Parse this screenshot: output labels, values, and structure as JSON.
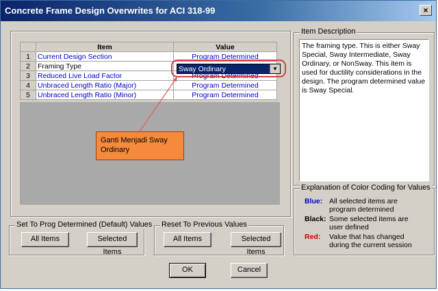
{
  "window": {
    "title": "Concrete Frame Design Overwrites for ACI 318-99",
    "close_label": "×"
  },
  "grid": {
    "headers": {
      "item": "Item",
      "value": "Value"
    },
    "rows": [
      {
        "num": "1",
        "item": "Current Design Section",
        "value": "Program Determined"
      },
      {
        "num": "2",
        "item": "Framing Type",
        "value": ""
      },
      {
        "num": "3",
        "item": "Reduced Live Load Factor",
        "value": "Program Determined"
      },
      {
        "num": "4",
        "item": "Unbraced Length Ratio (Major)",
        "value": "Program Determined"
      },
      {
        "num": "5",
        "item": "Unbraced Length Ratio (Minor)",
        "value": "Program Determined"
      }
    ],
    "dropdown": {
      "selected": "Sway Ordinary",
      "arrow": "▼"
    }
  },
  "annotation": {
    "callout_text": "Ganti Menjadi Sway Ordinary"
  },
  "description": {
    "label": "Item Description",
    "text": "The framing type.  This is either Sway Special, Sway Intermediate, Sway Ordinary, or NonSway.  This item is used for ductility considerations in the design.  The program determined value is Sway Special."
  },
  "legend": {
    "label": "Explanation of Color Coding for Values",
    "entries": [
      {
        "key": "Blue:",
        "color": "#0000cc",
        "text": "All selected items are program determined"
      },
      {
        "key": "Black:",
        "color": "#000000",
        "text": "Some selected items are user defined"
      },
      {
        "key": "Red:",
        "color": "#cc0000",
        "text": "Value that has changed during the current session"
      }
    ]
  },
  "set_default": {
    "label": "Set To Prog Determined (Default) Values",
    "all_items": "All Items",
    "selected_items": "Selected Items"
  },
  "reset_previous": {
    "label": "Reset To Previous Values",
    "all_items": "All Items",
    "selected_items": "Selected Items"
  },
  "buttons": {
    "ok": "OK",
    "cancel": "Cancel"
  }
}
